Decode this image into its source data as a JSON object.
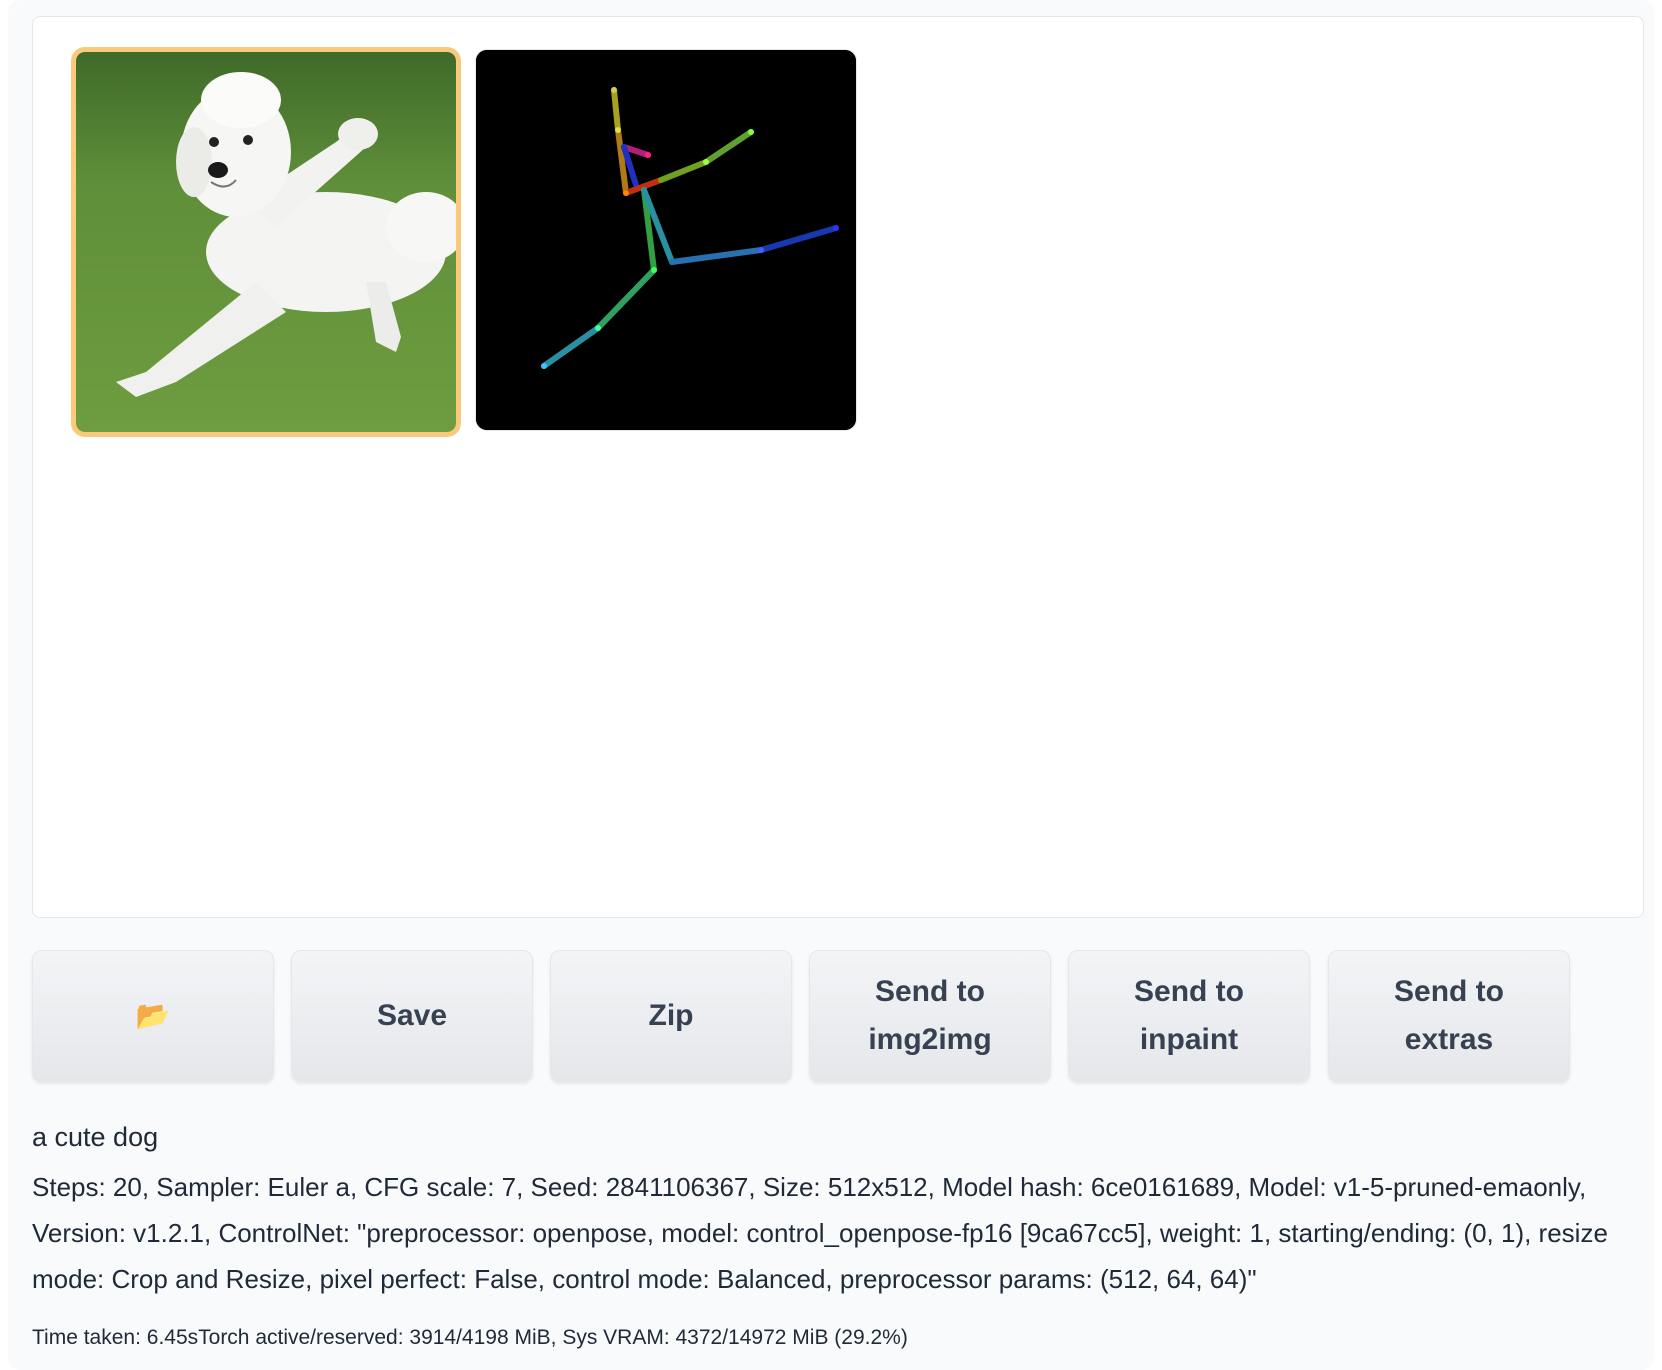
{
  "buttons": {
    "open_folder_icon": "📂",
    "save": "Save",
    "zip": "Zip",
    "send_img2img": "Send to\nimg2img",
    "send_inpaint": "Send to\ninpaint",
    "send_extras": "Send to\nextras"
  },
  "output": {
    "prompt": "a cute dog",
    "params": "Steps: 20, Sampler: Euler a, CFG scale: 7, Seed: 2841106367, Size: 512x512, Model hash: 6ce0161689, Model: v1-5-pruned-emaonly, Version: v1.2.1, ControlNet: \"preprocessor: openpose, model: control_openpose-fp16 [9ca67cc5], weight: 1, starting/ending: (0, 1), resize mode: Crop and Resize, pixel perfect: False, control mode: Balanced, preprocessor params: (512, 64, 64)\"",
    "timing": "Time taken: 6.45sTorch active/reserved: 3914/4198 MiB, Sys VRAM: 4372/14972 MiB (29.2%)"
  },
  "colors": {
    "selected_border": "#fbc97a",
    "panel_bg": "#f9fafb",
    "button_text": "#374151"
  }
}
